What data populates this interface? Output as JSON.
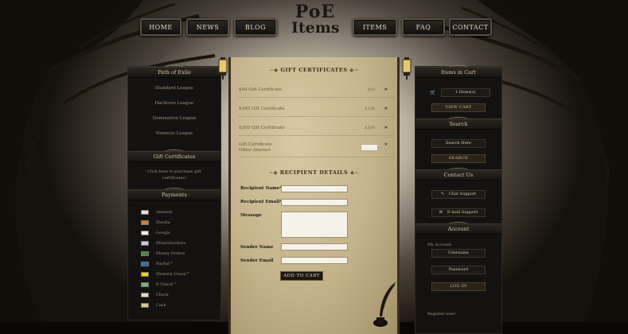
{
  "logo": {
    "line1": "PoE",
    "line2": "Items"
  },
  "nav": {
    "home": "HOME",
    "news": "NEWS",
    "blog": "BLOG",
    "items": "ITEMS",
    "faq": "FAQ",
    "contact": "CONTACT"
  },
  "left": {
    "leagues_title": "Path of Exile",
    "leagues": [
      "Standard League",
      "Hardcore League",
      "Domination League",
      "Nemesis League"
    ],
    "gift_title": "Gift Certificates",
    "gift_text": "Click here to purchase gift certificates!",
    "payments_title": "Payments",
    "payments": [
      "Amazon",
      "Dwolla",
      "Google",
      "Moneybookers",
      "Money Orders",
      "PayPal™",
      "Western Union™",
      "E-Check™",
      "Check",
      "Cash"
    ]
  },
  "main": {
    "gift_heading": "GIFT CERTIFICATES",
    "certs": [
      {
        "label": "$50 Gift Certificate",
        "price": "$50"
      },
      {
        "label": "$100 Gift Certificate",
        "price": "$100"
      },
      {
        "label": "$200 Gift Certificate",
        "price": "$200"
      }
    ],
    "other_label_1": "Gift Certificate",
    "other_label_2": "Other Amount",
    "recipient_heading": "RECIPIENT DETAILS",
    "recipient_name": "Recipient Name*",
    "recipient_email": "Recipient Email*",
    "message": "Message",
    "sender_name": "Sender Name",
    "sender_email": "Sender Email",
    "add_to_cart": "ADD TO CART"
  },
  "right": {
    "cart_title": "Items in Cart",
    "cart_count": "1 Items(s)",
    "view_cart": "VIEW CART",
    "search_title": "Search",
    "search_placeholder": "Search Here",
    "search_btn": "SEARCH",
    "contact_title": "Contact Us",
    "chat_support": "Chat Support",
    "email_support": "E-mail Support",
    "account_title": "Account",
    "my_account": "My Account",
    "username_placeholder": "Username",
    "password_placeholder": "Password",
    "login_btn": "LOG IN",
    "register": "Register now!"
  },
  "colors": {
    "panel_bg": "#141210",
    "parchment": "#c4b28b",
    "accent_gold": "#d9bd82"
  }
}
